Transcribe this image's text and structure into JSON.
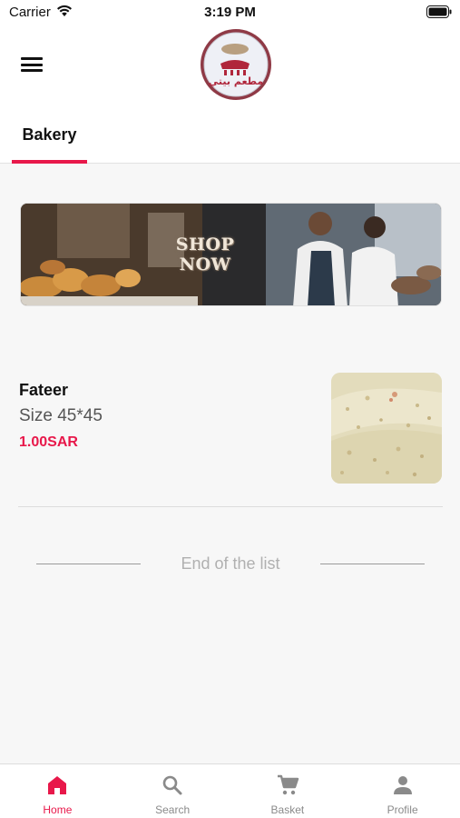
{
  "status_bar": {
    "carrier": "Carrier",
    "time": "3:19 PM"
  },
  "header": {
    "menu_icon": "hamburger-menu-icon",
    "logo_text": "مطعم بيتي"
  },
  "tabs": [
    {
      "label": "Bakery",
      "active": true
    }
  ],
  "banner": {
    "text": "SHOP NOW"
  },
  "products": [
    {
      "name": "Fateer",
      "size": "Size 45*45",
      "price": "1.00SAR"
    }
  ],
  "list_end": {
    "text": "End of the list"
  },
  "bottom_nav": {
    "items": [
      {
        "label": "Home",
        "icon": "home-icon",
        "active": true
      },
      {
        "label": "Search",
        "icon": "search-icon",
        "active": false
      },
      {
        "label": "Basket",
        "icon": "cart-icon",
        "active": false
      },
      {
        "label": "Profile",
        "icon": "person-icon",
        "active": false
      }
    ]
  },
  "colors": {
    "accent": "#e8184a",
    "background": "#f7f7f7",
    "logo": "#8f3a46"
  }
}
